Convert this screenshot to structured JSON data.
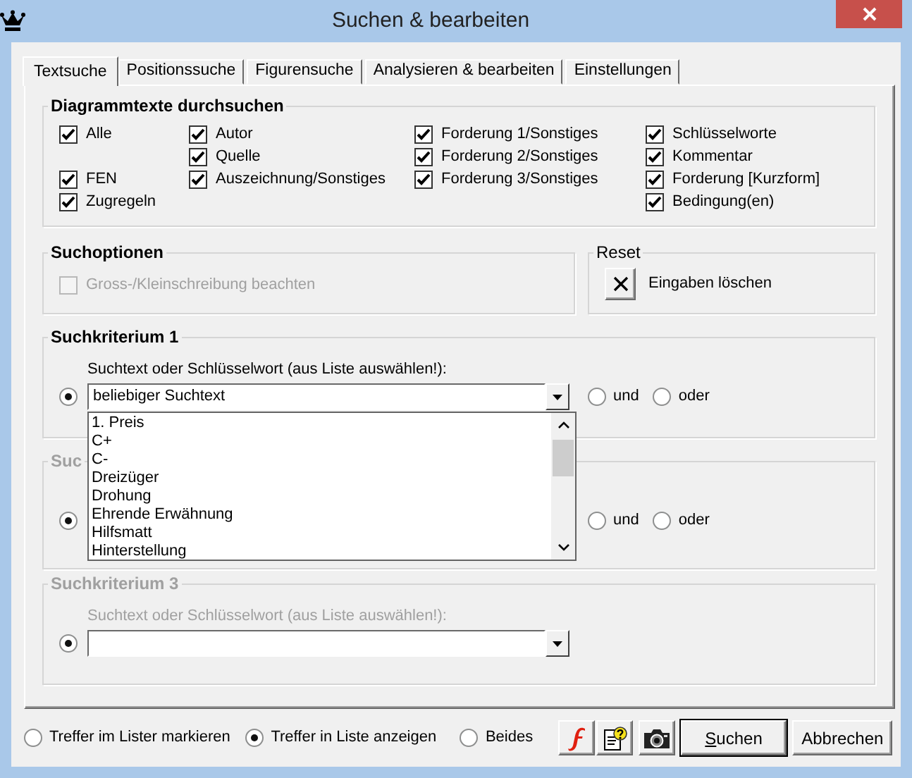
{
  "window": {
    "title": "Suchen & bearbeiten"
  },
  "tabs": [
    {
      "label": "Textsuche",
      "selected": true
    },
    {
      "label": "Positionssuche",
      "selected": false
    },
    {
      "label": "Figurensuche",
      "selected": false
    },
    {
      "label": "Analysieren & bearbeiten",
      "selected": false
    },
    {
      "label": "Einstellungen",
      "selected": false
    }
  ],
  "diagram_texts": {
    "title": "Diagrammtexte durchsuchen",
    "columns": [
      {
        "groups": [
          {
            "items": [
              {
                "label": "Alle",
                "checked": true
              }
            ]
          },
          {
            "items": [
              {
                "label": "FEN",
                "checked": true
              },
              {
                "label": "Zugregeln",
                "checked": true
              }
            ]
          }
        ]
      },
      {
        "groups": [
          {
            "items": [
              {
                "label": "Autor",
                "checked": true
              },
              {
                "label": "Quelle",
                "checked": true
              },
              {
                "label": "Auszeichnung/Sonstiges",
                "checked": true
              }
            ]
          }
        ]
      },
      {
        "groups": [
          {
            "items": [
              {
                "label": "Forderung 1/Sonstiges",
                "checked": true
              },
              {
                "label": "Forderung 2/Sonstiges",
                "checked": true
              },
              {
                "label": "Forderung 3/Sonstiges",
                "checked": true
              }
            ]
          }
        ]
      },
      {
        "groups": [
          {
            "items": [
              {
                "label": "Schlüsselworte",
                "checked": true
              },
              {
                "label": "Kommentar",
                "checked": true
              },
              {
                "label": "Forderung [Kurzform]",
                "checked": true
              },
              {
                "label": "Bedingung(en)",
                "checked": true
              }
            ]
          }
        ]
      }
    ]
  },
  "search_options": {
    "title": "Suchoptionen",
    "checkboxes": [
      {
        "label": "Gross-/Kleinschreibung beachten",
        "checked": false,
        "disabled": true
      }
    ]
  },
  "reset": {
    "title": "Reset",
    "label": "Eingaben löschen"
  },
  "criteria": [
    {
      "title": "Suchkriterium 1",
      "disabled": false,
      "checked": true,
      "prompt": "Suchtext oder Schlüsselwort (aus Liste auswählen!):",
      "value": "beliebiger Suchtext",
      "dropdown": {
        "items": [
          "1. Preis",
          "C+",
          "C-",
          "Dreizüger",
          "Drohung",
          "Ehrende Erwähnung",
          "Hilfsmatt",
          "Hinterstellung"
        ]
      },
      "connectors": [
        {
          "label": "und",
          "selected": false
        },
        {
          "label": "oder",
          "selected": false
        }
      ]
    },
    {
      "title": "Suc",
      "disabled": true,
      "checked": true,
      "connectors": [
        {
          "label": "und",
          "selected": false
        },
        {
          "label": "oder",
          "selected": false
        }
      ]
    },
    {
      "title": "Suchkriterium 3",
      "disabled": true,
      "checked": true,
      "prompt": "Suchtext oder Schlüsselwort (aus Liste auswählen!):"
    }
  ],
  "result_modes": [
    {
      "label": "Treffer im Lister markieren",
      "selected": false
    },
    {
      "label": "Treffer in Liste anzeigen",
      "selected": true
    },
    {
      "label": "Beides",
      "selected": false
    }
  ],
  "buttons": [
    {
      "kind": "flash"
    },
    {
      "kind": "help"
    },
    {
      "kind": "camera"
    },
    {
      "kind": "text",
      "label": "Suchen",
      "default": true,
      "first_letter_underlined": true
    },
    {
      "kind": "text",
      "label": "Abbrechen",
      "default": false,
      "first_letter_underlined": false
    }
  ]
}
